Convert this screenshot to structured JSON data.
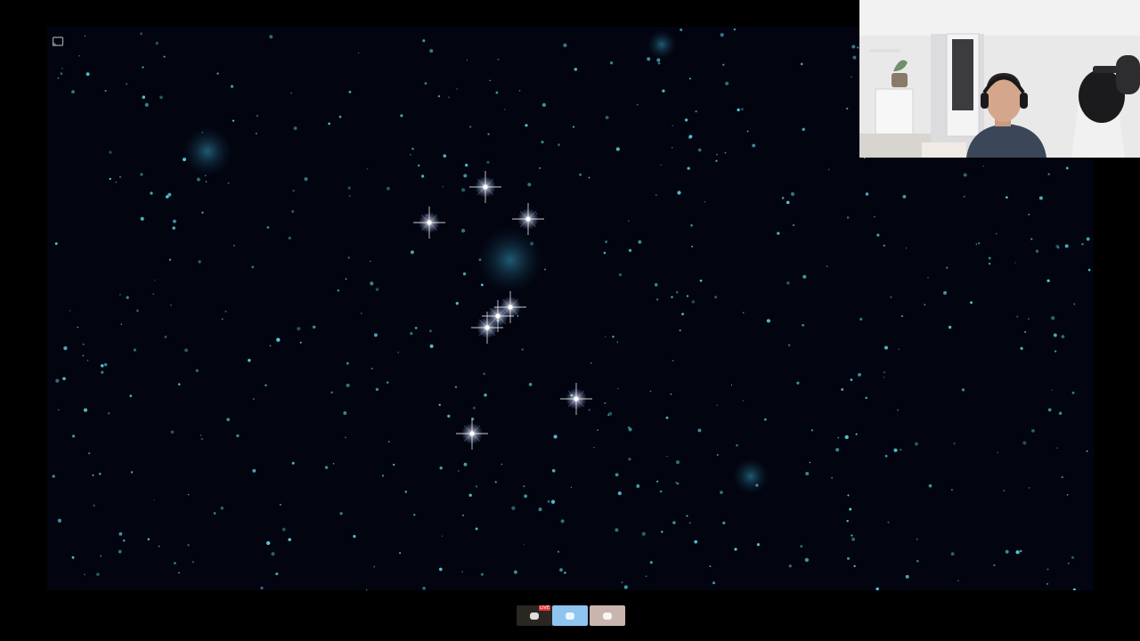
{
  "viewer": {
    "background_color": "#000000",
    "sky_color": "#02040f",
    "faint_star_color": "#5ad4e6",
    "bright_star_color": "#ffffff",
    "cast_icon": "cast-icon"
  },
  "webcam": {
    "visible": true,
    "content": "webcam-feed"
  },
  "thumbnails": [
    {
      "name": "thumbnail-1",
      "badge": "LIVE",
      "color": "#2a2622"
    },
    {
      "name": "thumbnail-2",
      "color": "#8ec4f0"
    },
    {
      "name": "thumbnail-3",
      "color": "#c9b4ae"
    }
  ]
}
